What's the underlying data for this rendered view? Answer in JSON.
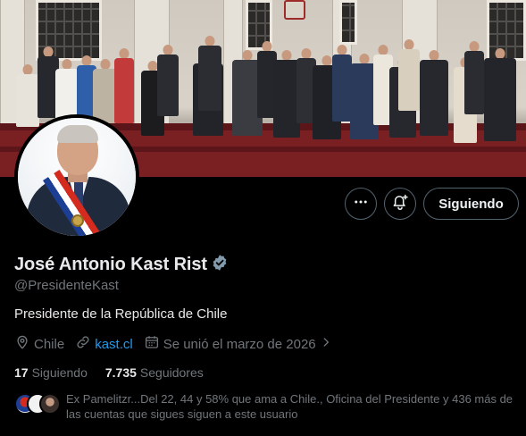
{
  "profile": {
    "display_name": "José Antonio Kast Rist",
    "handle": "@PresidenteKast",
    "bio": "Presidente de la República de Chile",
    "location": "Chile",
    "website": "kast.cl",
    "joined": "Se unió el marzo de 2026"
  },
  "stats": {
    "following_count": "17",
    "following_label": "Siguiendo",
    "followers_count": "7.735",
    "followers_label": "Seguidores"
  },
  "actions": {
    "follow_label": "Siguiendo",
    "more_icon": "more-horizontal-icon",
    "notify_icon": "bell-plus-icon"
  },
  "mutuals": {
    "text": "Ex Pamelitzr...Del 22, 44 y 58% que ama a Chile., Oficina del Presidente y 436 más de las cuentas que sigues siguen a este usuario"
  },
  "colors": {
    "background": "#000000",
    "text_primary": "#e7e9ea",
    "text_secondary": "#71767b",
    "link": "#1d9bf0",
    "border": "#536471",
    "verified_badge": "#829aab"
  }
}
